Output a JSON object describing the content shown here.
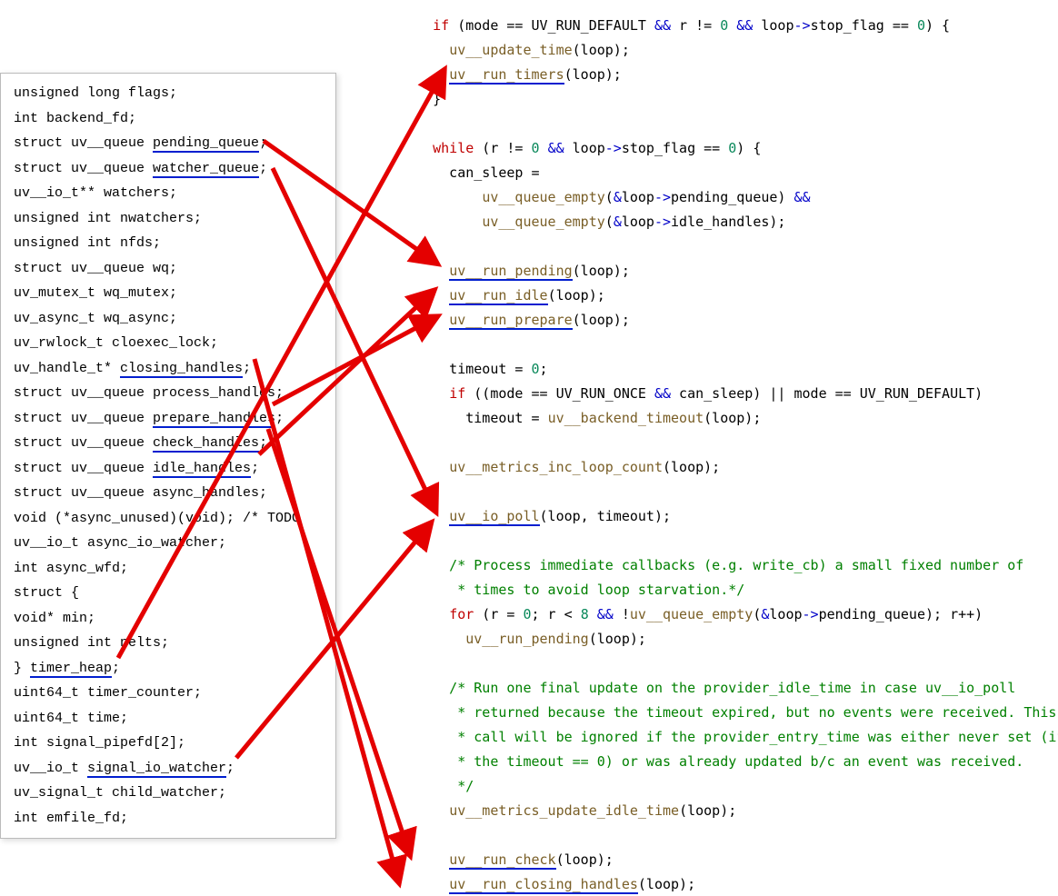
{
  "left": {
    "l1": "unsigned long flags;",
    "l2": "int backend_fd;",
    "l3p": "struct uv__queue ",
    "l3u": "pending_queue",
    "l3s": ";",
    "l4p": "struct uv__queue ",
    "l4u": "watcher_queue",
    "l4s": ";",
    "l5": "uv__io_t** watchers;",
    "l6": "unsigned int nwatchers;",
    "l7": "unsigned int nfds;",
    "l8": "struct uv__queue wq;",
    "l9": "uv_mutex_t wq_mutex;",
    "l10": "uv_async_t wq_async;",
    "l11": "uv_rwlock_t cloexec_lock;",
    "l12p": "uv_handle_t* ",
    "l12u": "closing_handles",
    "l12s": ";",
    "l13": "struct uv__queue process_handles;",
    "l14p": "struct uv__queue ",
    "l14u": "prepare_handles",
    "l14s": ";",
    "l15p": "struct uv__queue ",
    "l15u": "check_handles",
    "l15s": ";",
    "l16p": "struct uv__queue ",
    "l16u": "idle_handles",
    "l16s": ";",
    "l17": "struct uv__queue async_handles;",
    "l18": "void (*async_unused)(void);  /* TODO",
    "l19": "uv__io_t async_io_watcher;",
    "l20": "int async_wfd;",
    "l21": "struct {",
    "l22": "   void* min;",
    "l23": "   unsigned int nelts;",
    "l24p": "} ",
    "l24u": "timer_heap",
    "l24s": ";",
    "l25": "uint64_t timer_counter;",
    "l26": "uint64_t time;",
    "l27": "int signal_pipefd[2];",
    "l28p": "uv__io_t ",
    "l28u": "signal_io_watcher",
    "l28s": ";",
    "l29": "uv_signal_t child_watcher;",
    "l30": "int emfile_fd;"
  },
  "right": {
    "r1_if": "if",
    "r1_a": " (mode == UV_RUN_DEFAULT ",
    "r1_and": "&&",
    "r1_b": " r != ",
    "r1_zero": "0",
    "r1_c": " ",
    "r1_and2": "&&",
    "r1_d": " loop",
    "r1_arrow": "->",
    "r1_e": "stop_flag == ",
    "r1_zero2": "0",
    "r1_f": ") {",
    "r2_a": "      ",
    "r2_fn": "uv__update_time",
    "r2_b": "(loop);",
    "r3_a": "      ",
    "r3_fn": "uv__run_timers",
    "r3_b": "(loop);",
    "r4": "    }",
    "r5": "",
    "r6_a": "    ",
    "r6_while": "while",
    "r6_b": " (r != ",
    "r6_zero": "0",
    "r6_c": " ",
    "r6_and": "&&",
    "r6_d": " loop",
    "r6_arrow": "->",
    "r6_e": "stop_flag == ",
    "r6_zero2": "0",
    "r6_f": ") {",
    "r7": "      can_sleep =",
    "r8_a": "          ",
    "r8_fn": "uv__queue_empty",
    "r8_b": "(",
    "r8_amp": "&",
    "r8_c": "loop",
    "r8_arrow": "->",
    "r8_d": "pending_queue) ",
    "r8_and": "&&",
    "r9_a": "          ",
    "r9_fn": "uv__queue_empty",
    "r9_b": "(",
    "r9_amp": "&",
    "r9_c": "loop",
    "r9_arrow": "->",
    "r9_d": "idle_handles);",
    "r10": "",
    "r11_a": "      ",
    "r11_fn": "uv__run_pending",
    "r11_b": "(loop);",
    "r12_a": "      ",
    "r12_fn": "uv__run_idle",
    "r12_b": "(loop);",
    "r13_a": "      ",
    "r13_fn": "uv__run_prepare",
    "r13_b": "(loop);",
    "r14": "",
    "r15_a": "      timeout = ",
    "r15_zero": "0",
    "r15_b": ";",
    "r16_a": "      ",
    "r16_if": "if",
    "r16_b": " ((mode == UV_RUN_ONCE ",
    "r16_and": "&&",
    "r16_c": " can_sleep) || mode == UV_RUN_DEFAULT)",
    "r17_a": "        timeout = ",
    "r17_fn": "uv__backend_timeout",
    "r17_b": "(loop);",
    "r18": "",
    "r19_a": "      ",
    "r19_fn": "uv__metrics_inc_loop_count",
    "r19_b": "(loop);",
    "r20": "",
    "r21_a": "      ",
    "r21_fn": "uv__io_poll",
    "r21_b": "(loop, timeout);",
    "r22": "",
    "r23": "      /* Process immediate callbacks (e.g. write_cb) a small fixed number of",
    "r24": "       * times to avoid loop starvation.*/",
    "r25_a": "      ",
    "r25_for": "for",
    "r25_b": " (r = ",
    "r25_zero": "0",
    "r25_c": "; r < ",
    "r25_eight": "8",
    "r25_d": " ",
    "r25_and": "&&",
    "r25_e": " !",
    "r25_fn": "uv__queue_empty",
    "r25_f": "(",
    "r25_amp": "&",
    "r25_g": "loop",
    "r25_arrow": "->",
    "r25_h": "pending_queue); r++)",
    "r26_a": "        ",
    "r26_fn": "uv__run_pending",
    "r26_b": "(loop);",
    "r27": "",
    "r28": "      /* Run one final update on the provider_idle_time in case uv__io_poll",
    "r29": "       * returned because the timeout expired, but no events were received. This",
    "r30": "       * call will be ignored if the provider_entry_time was either never set (if",
    "r31": "       * the timeout == 0) or was already updated b/c an event was received.",
    "r32": "       */",
    "r33_a": "      ",
    "r33_fn": "uv__metrics_update_idle_time",
    "r33_b": "(loop);",
    "r34": "",
    "r35_a": "      ",
    "r35_fn": "uv__run_check",
    "r35_b": "(loop);",
    "r36_a": "      ",
    "r36_fn": "uv__run_closing_handles",
    "r36_b": "(loop);"
  }
}
